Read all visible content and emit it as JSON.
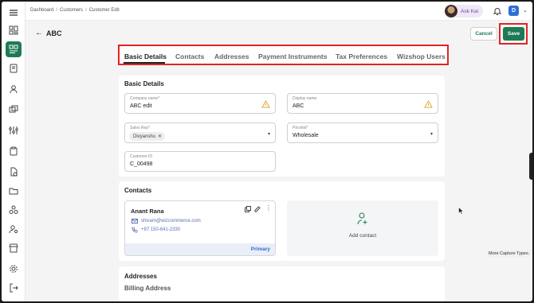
{
  "topbar": {
    "breadcrumbs": [
      "Dashboard",
      "Customers",
      "Customer Edit"
    ],
    "breadcrumb_sep": "/",
    "ask_kai": "Ask Kai",
    "user_initial": "D"
  },
  "header": {
    "title": "ABC",
    "cancel_label": "Cancel",
    "save_label": "Save"
  },
  "tabs": [
    {
      "label": "Basic Details",
      "active": true
    },
    {
      "label": "Contacts"
    },
    {
      "label": "Addresses"
    },
    {
      "label": "Payment Instruments"
    },
    {
      "label": "Tax Preferences"
    },
    {
      "label": "Wizshop Users"
    }
  ],
  "basic_details": {
    "title": "Basic Details",
    "company_name": {
      "label": "Company name*",
      "value": "ABC edit"
    },
    "display_name": {
      "label": "Display name",
      "value": "ABC"
    },
    "sales_rep": {
      "label": "Sales Rep*",
      "chip": "Divyanshu"
    },
    "pricelist": {
      "label": "Pricelist*",
      "value": "Wholesale"
    },
    "customer_id": {
      "label": "Customer ID",
      "value": "C_00498"
    }
  },
  "contacts": {
    "title": "Contacts",
    "card": {
      "name": "Anant Rana",
      "email": "shivam@wizcommerce.com",
      "phone": "+97 150-641-2330",
      "tag": "Primary"
    },
    "add_label": "Add contact"
  },
  "addresses": {
    "title": "Addresses",
    "billing_title": "Billing Address"
  },
  "tooltip": "More Capture Types.",
  "colors": {
    "accent": "#1e7a55",
    "highlight": "#e02424",
    "link": "#2c6fd6"
  }
}
